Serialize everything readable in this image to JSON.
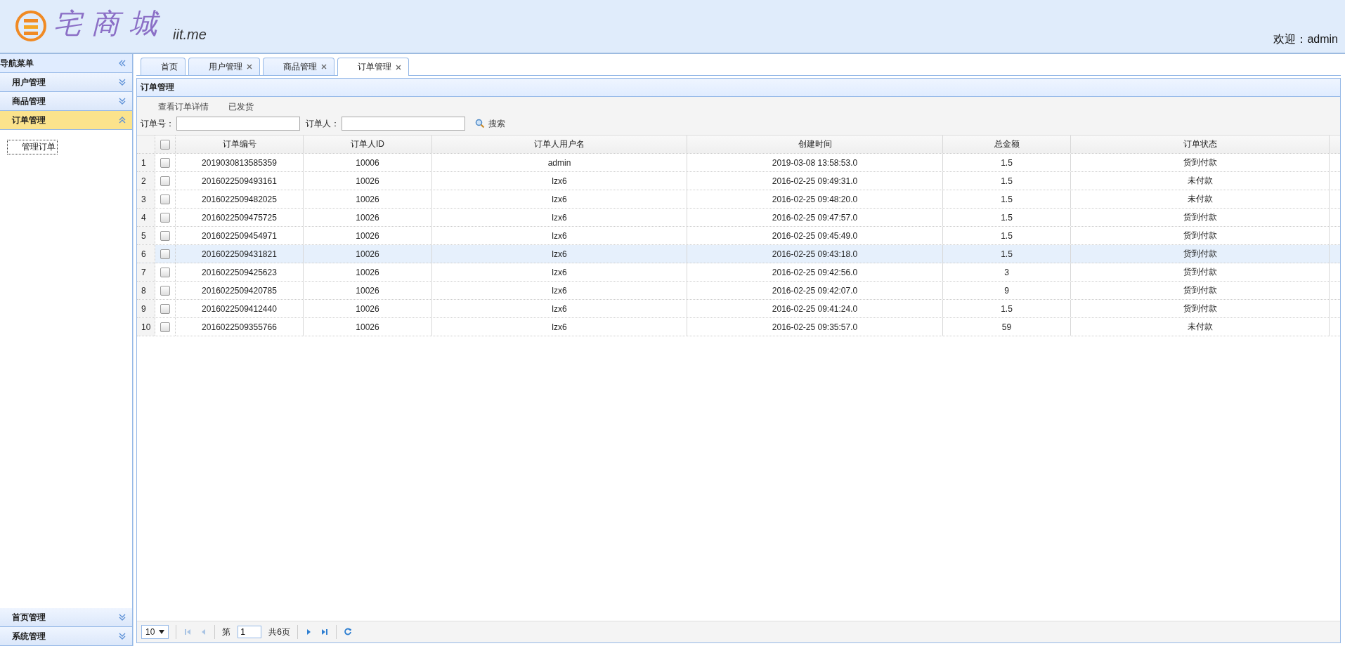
{
  "header": {
    "logo_text": "宅商城",
    "logo_domain": "iit.me",
    "welcome": "欢迎：admin"
  },
  "sidebar": {
    "title": "导航菜单",
    "sections": [
      {
        "label": "用户管理",
        "expanded": false
      },
      {
        "label": "商品管理",
        "expanded": false
      },
      {
        "label": "订单管理",
        "expanded": true,
        "children": [
          {
            "label": "管理订单",
            "selected": true
          }
        ]
      },
      {
        "label": "首页管理",
        "expanded": false
      },
      {
        "label": "系统管理",
        "expanded": false
      }
    ]
  },
  "tabs": [
    {
      "label": "首页",
      "closable": false,
      "selected": false
    },
    {
      "label": "用户管理",
      "closable": true,
      "selected": false
    },
    {
      "label": "商品管理",
      "closable": true,
      "selected": false
    },
    {
      "label": "订单管理",
      "closable": true,
      "selected": true
    }
  ],
  "panel": {
    "title": "订单管理",
    "toolbar": [
      "查看订单详情",
      "已发货"
    ],
    "search": {
      "order_no_label": "订单号：",
      "customer_label": "订单人：",
      "button": "搜索"
    },
    "table": {
      "select_all_checked": false,
      "columns": [
        "订单编号",
        "订单人ID",
        "订单人用户名",
        "创建时间",
        "总金额",
        "订单状态"
      ],
      "rows": [
        {
          "index": "1",
          "checked": false,
          "highlighted": false,
          "cells": [
            "2019030813585359",
            "10006",
            "admin",
            "2019-03-08 13:58:53.0",
            "1.5",
            "货到付款"
          ]
        },
        {
          "index": "2",
          "checked": false,
          "highlighted": false,
          "cells": [
            "2016022509493161",
            "10026",
            "lzx6",
            "2016-02-25 09:49:31.0",
            "1.5",
            "未付款"
          ]
        },
        {
          "index": "3",
          "checked": false,
          "highlighted": false,
          "cells": [
            "2016022509482025",
            "10026",
            "lzx6",
            "2016-02-25 09:48:20.0",
            "1.5",
            "未付款"
          ]
        },
        {
          "index": "4",
          "checked": false,
          "highlighted": false,
          "cells": [
            "2016022509475725",
            "10026",
            "lzx6",
            "2016-02-25 09:47:57.0",
            "1.5",
            "货到付款"
          ]
        },
        {
          "index": "5",
          "checked": false,
          "highlighted": false,
          "cells": [
            "2016022509454971",
            "10026",
            "lzx6",
            "2016-02-25 09:45:49.0",
            "1.5",
            "货到付款"
          ]
        },
        {
          "index": "6",
          "checked": false,
          "highlighted": true,
          "cells": [
            "2016022509431821",
            "10026",
            "lzx6",
            "2016-02-25 09:43:18.0",
            "1.5",
            "货到付款"
          ]
        },
        {
          "index": "7",
          "checked": false,
          "highlighted": false,
          "cells": [
            "2016022509425623",
            "10026",
            "lzx6",
            "2016-02-25 09:42:56.0",
            "3",
            "货到付款"
          ]
        },
        {
          "index": "8",
          "checked": false,
          "highlighted": false,
          "cells": [
            "2016022509420785",
            "10026",
            "lzx6",
            "2016-02-25 09:42:07.0",
            "9",
            "货到付款"
          ]
        },
        {
          "index": "9",
          "checked": false,
          "highlighted": false,
          "cells": [
            "2016022509412440",
            "10026",
            "lzx6",
            "2016-02-25 09:41:24.0",
            "1.5",
            "货到付款"
          ]
        },
        {
          "index": "10",
          "checked": false,
          "highlighted": false,
          "cells": [
            "2016022509355766",
            "10026",
            "lzx6",
            "2016-02-25 09:35:57.0",
            "59",
            "未付款"
          ]
        }
      ]
    },
    "pager": {
      "page_size": "10",
      "page_prefix": "第",
      "page": "1",
      "page_total": "共6页"
    }
  }
}
